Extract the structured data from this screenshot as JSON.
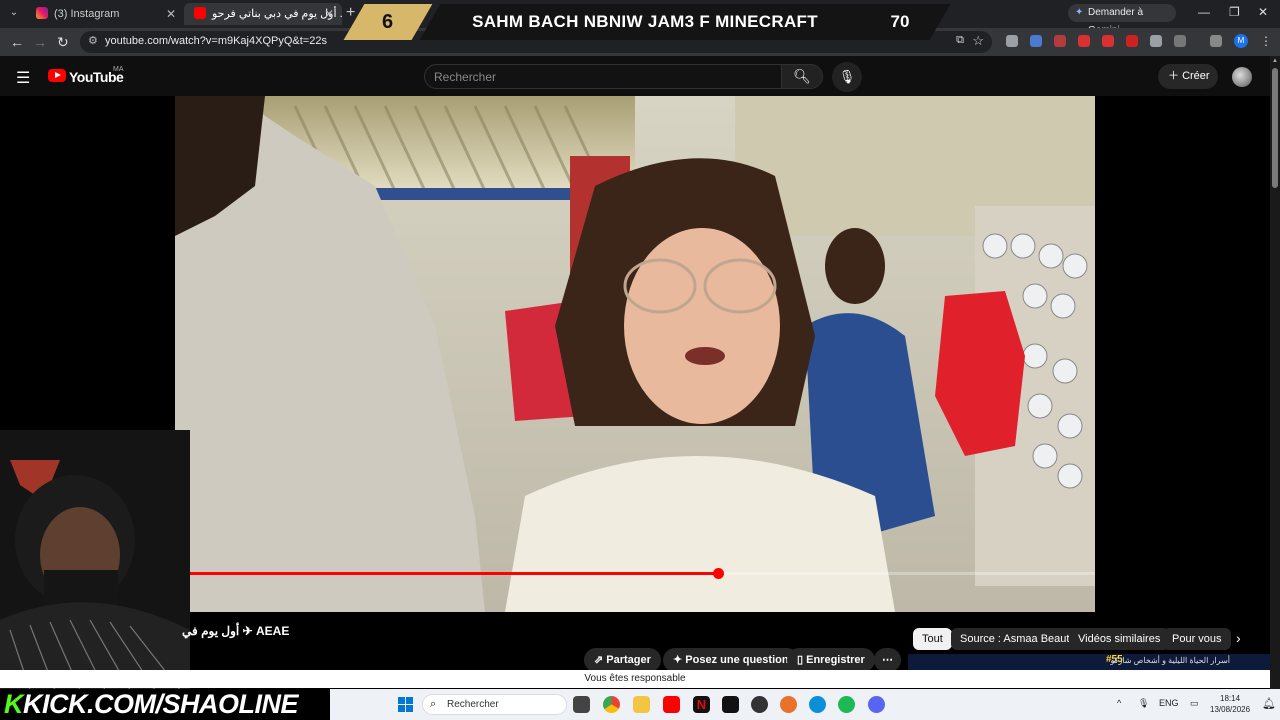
{
  "browser": {
    "tabs": [
      {
        "label": "(3) Instagram"
      },
      {
        "label": "أول يوم في دبي بناتي فرحو ..."
      }
    ],
    "gemini_button": "Demander à Gemini",
    "url": "youtube.com/watch?v=m9Kaj4XQPyQ&t=22s"
  },
  "stream_overlay": {
    "left_number": "6",
    "title": "SAHM BACH NBNIW JAM3 F MINECRAFT",
    "right_number": "70"
  },
  "youtube": {
    "logo_text": "YouTube",
    "region": "MA",
    "search_placeholder": "Rechercher",
    "create_label": "Créer",
    "video_title": "أول يوم في",
    "video_title_suffix": "AEAE",
    "progress_fraction": 0.59,
    "chips": [
      "Tout",
      "Source : Asmaa Beauty",
      "Vidéos similaires",
      "Pour vous"
    ],
    "actions": {
      "share": "Partager",
      "ask": "Posez une question",
      "save": "Enregistrer"
    },
    "thumb_text": "أسرار الحياة الليلية و أشخاص شاركو",
    "thumb_number": "#55",
    "notice": "Vous êtes responsable"
  },
  "kick_banner": {
    "k": "K",
    "text": "KICK.COM/SHAOLINE"
  },
  "taskbar": {
    "search_label": "Rechercher",
    "language": "ENG",
    "time": "18:14",
    "date": "13/08/2026"
  },
  "colors": {
    "youtube_red": "#ff0000",
    "kick_green": "#53fc18",
    "overlay_gold": "#d7b86a",
    "taskbar_bg": "#eef2f7"
  }
}
